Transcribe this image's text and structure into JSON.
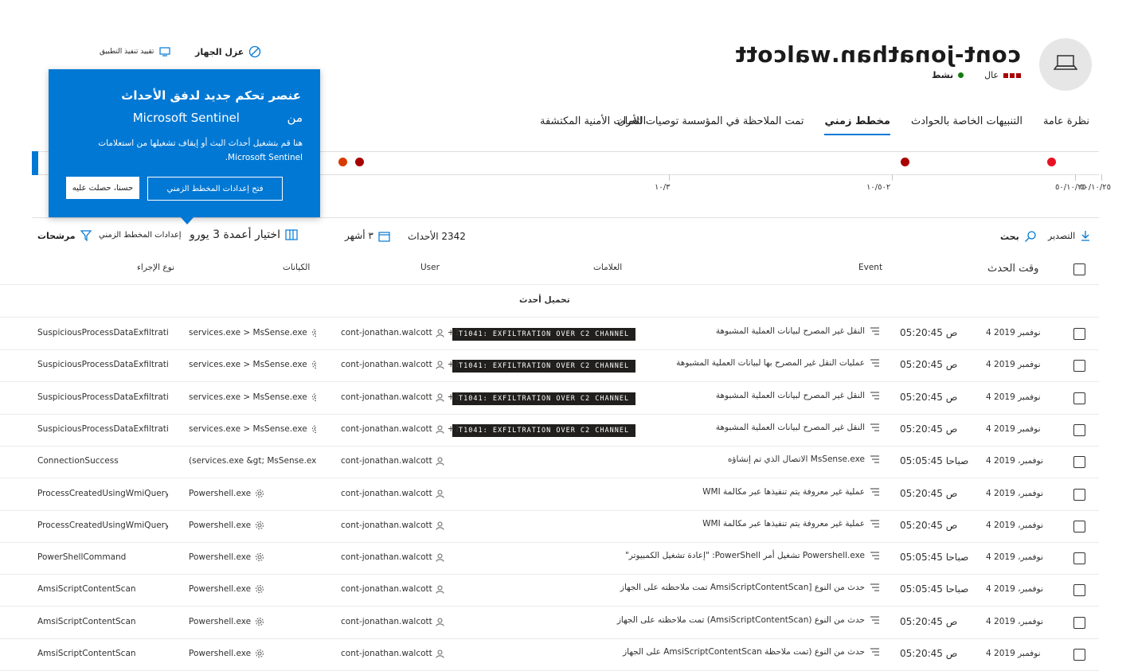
{
  "device": {
    "name": "cont-jonathan.walcott",
    "risk_label": "عال",
    "health_label": "نشط"
  },
  "top_actions": {
    "isolate": "عزل الجهاز",
    "restrict": "تقييد تنفيذ التطبيق"
  },
  "tabs": [
    "نظرة عامة",
    "التنبيهات الخاصة بالحوادث",
    "مخطط زمني",
    "تمت الملاحظة في المؤسسة توصيات الأمان",
    "الثغرات الأمنية المكتشفة"
  ],
  "timeline": {
    "labels": [
      "٥٠/١٠/٢٥",
      "٥٠/١٠/٢٥",
      "١٠/٥٠٢",
      "١٠/٣"
    ],
    "colors": {
      "red": "#e81123",
      "dark_red": "#a80000",
      "orange": "#d83b01",
      "blue": "#0078d4"
    }
  },
  "popup": {
    "title": "عنصر تحكم جديد لدفق الأحداث",
    "title_from": "من",
    "title_product": "Microsoft Sentinel",
    "body": "هنا قم بتشغيل أحداث البث أو إيقاف تشغيلها من استعلامات Microsoft Sentinel.",
    "primary_button": "فتح إعدادات المخطط الزمني",
    "secondary_button": "حسنا، حصلت عليه"
  },
  "toolbar": {
    "export": "التصدير",
    "search": "بحث",
    "events_count": "2342 الأحداث",
    "months": "٣ أشهر",
    "choose_columns": "اختيار أعمدة 3 يورو",
    "timeline_settings": "إعدادات المخطط الزمني",
    "filters": "مرشحات"
  },
  "columns": {
    "event_time": "وقت الحدث",
    "event": "Event",
    "tags": "العلامات",
    "user": "User",
    "entities": "الكيانات",
    "action_type": "نوع الإجراء"
  },
  "load_newer": "تحميل أحدث",
  "rows": [
    {
      "date": "4 نوفمبر 2019",
      "time": "05:20:45 ص",
      "event": "النقل غير المصرح لبيانات العملية المشبوهة",
      "tag": "T1041: EXFILTRATION OVER C2 CHANNEL",
      "user": "cont-jonathan.walcott",
      "user_extra": "+1",
      "entity": "services.exe > MsSense.exe",
      "action": "SuspiciousProcessDataExfiltration"
    },
    {
      "date": "4 نوفمبر 2019",
      "time": "05:20:45 ص",
      "event": "عمليات النقل غير المصرح بها لبيانات العملية المشبوهة",
      "tag": "T1041: EXFILTRATION OVER C2 CHANNEL",
      "user": "cont-jonathan.walcott",
      "user_extra": "+1",
      "entity": "services.exe > MsSense.exe",
      "action": "SuspiciousProcessDataExfiltration"
    },
    {
      "date": "4 نوفمبر 2019",
      "time": "05:20:45 ص",
      "event": "النقل غير المصرح لبيانات العملية المشبوهة",
      "tag": "T1041: EXFILTRATION OVER C2 CHANNEL",
      "user": "cont-jonathan.walcott",
      "user_extra": "+1",
      "entity": "services.exe > MsSense.exe",
      "action": "SuspiciousProcessDataExfiltration"
    },
    {
      "date": "4 نوفمبر 2019",
      "time": "05:20:45 ص",
      "event": "النقل غير المصرح لبيانات العملية المشبوهة",
      "tag": "T1041: EXFILTRATION OVER C2 CHANNEL",
      "user": "cont-jonathan.walcott",
      "user_extra": "+1",
      "entity": "services.exe > MsSense.exe",
      "action": "SuspiciousProcessDataExfiltration"
    },
    {
      "date": "4 نوفمبر، 2019",
      "time": "05:05:45 صباحا",
      "event": "MsSense.exe الاتصال الذي تم إنشاؤه",
      "tag": "",
      "user": "cont-jonathan.walcott",
      "user_extra": "",
      "entity": "(services.exe &gt; MsSense.exe ((co",
      "action": "ConnectionSuccess"
    },
    {
      "date": "4 نوفمبر، 2019",
      "time": "05:20:45 ص",
      "event": "عملية غير معروفة يتم تنفيذها عبر مكالمة WMI",
      "tag": "",
      "user": "cont-jonathan.walcott",
      "user_extra": "",
      "entity": "Powershell.exe",
      "action": "ProcessCreatedUsingWmiQuery"
    },
    {
      "date": "4 نوفمبر، 2019",
      "time": "05:20:45 ص",
      "event": "عملية غير معروفة يتم تنفيذها عبر مكالمة WMI",
      "tag": "",
      "user": "cont-jonathan.walcott",
      "user_extra": "",
      "entity": "Powershell.exe",
      "action": "ProcessCreatedUsingWmiQuery"
    },
    {
      "date": "4 نوفمبر، 2019",
      "time": "05:05:45 صباحا",
      "event": "Powershell.exe تشغيل أمر PowerShell: \"إعادة تشغيل الكمبيوتر\"",
      "tag": "",
      "user": "cont-jonathan.walcott",
      "user_extra": "",
      "entity": "Powershell.exe",
      "action": "PowerShellCommand"
    },
    {
      "date": "4 نوفمبر، 2019",
      "time": "05:05:45 صباحا",
      "event": "حدث من النوع [AmsiScriptContentScan تمت ملاحظته على الجهاز",
      "tag": "",
      "user": "cont-jonathan.walcott",
      "user_extra": "",
      "entity": "Powershell.exe",
      "action": "AmsiScriptContentScan"
    },
    {
      "date": "4 نوفمبر، 2019",
      "time": "05:20:45 ص",
      "event": "حدث من النوع (AmsiScriptContentScan) تمت ملاحظته على الجهاز",
      "tag": "",
      "user": "cont-jonathan.walcott",
      "user_extra": "",
      "entity": "Powershell.exe",
      "action": "AmsiScriptContentScan"
    },
    {
      "date": "4 نوفمبر 2019",
      "time": "05:20:45 ص",
      "event": "حدث من النوع (تمت ملاحظة AmsiScriptContentScan على الجهاز",
      "tag": "",
      "user": "cont-jonathan.walcott",
      "user_extra": "",
      "entity": "Powershell.exe",
      "action": "AmsiScriptContentScan"
    }
  ]
}
